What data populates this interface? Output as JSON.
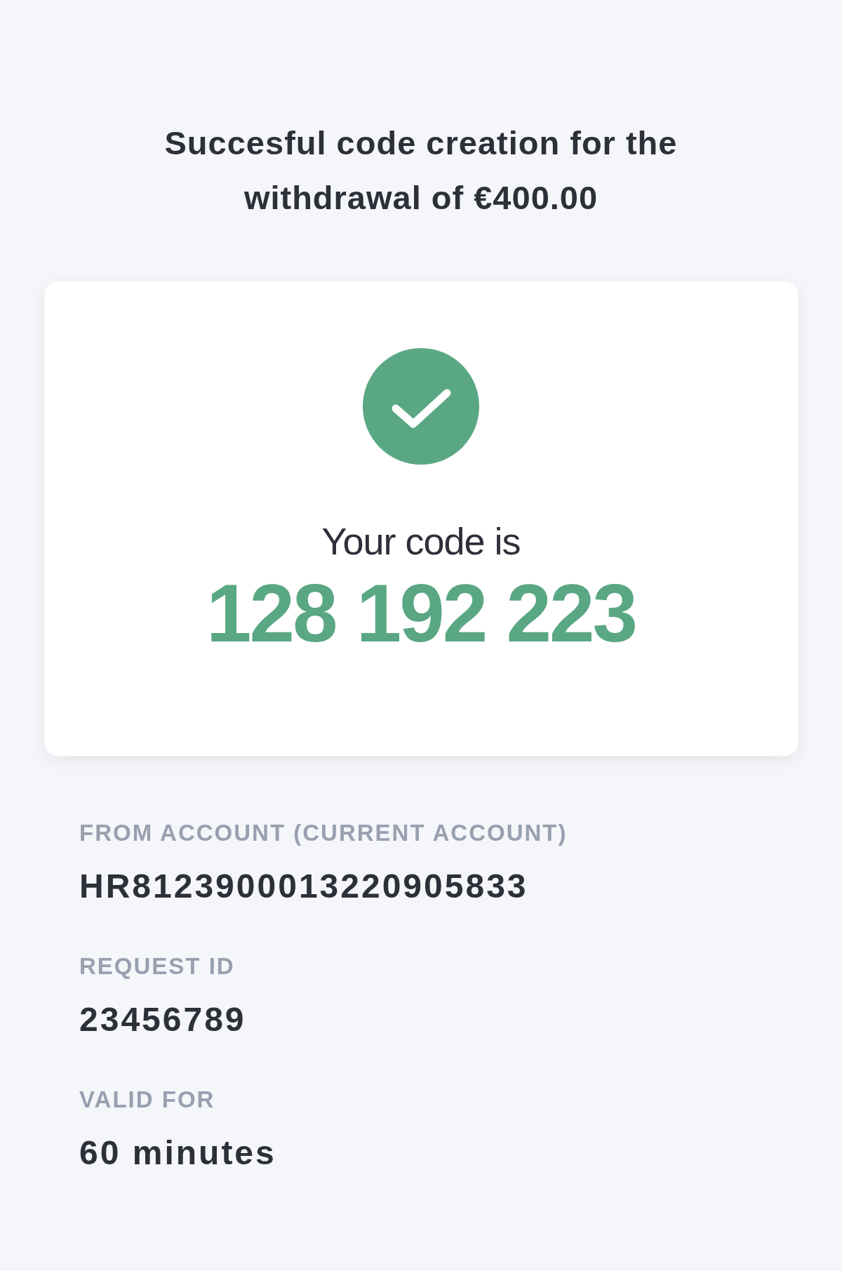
{
  "heading": "Succesful code creation for the withdrawal of €400.00",
  "card": {
    "kind": "success",
    "caption": "Your code is",
    "code": "128 192 223"
  },
  "details": [
    {
      "label": "FROM ACCOUNT (CURRENT ACCOUNT)",
      "value": "HR8123900013220905833"
    },
    {
      "label": "REQUEST ID",
      "value": "23456789"
    },
    {
      "label": "VALID FOR",
      "value": "60 minutes"
    }
  ]
}
